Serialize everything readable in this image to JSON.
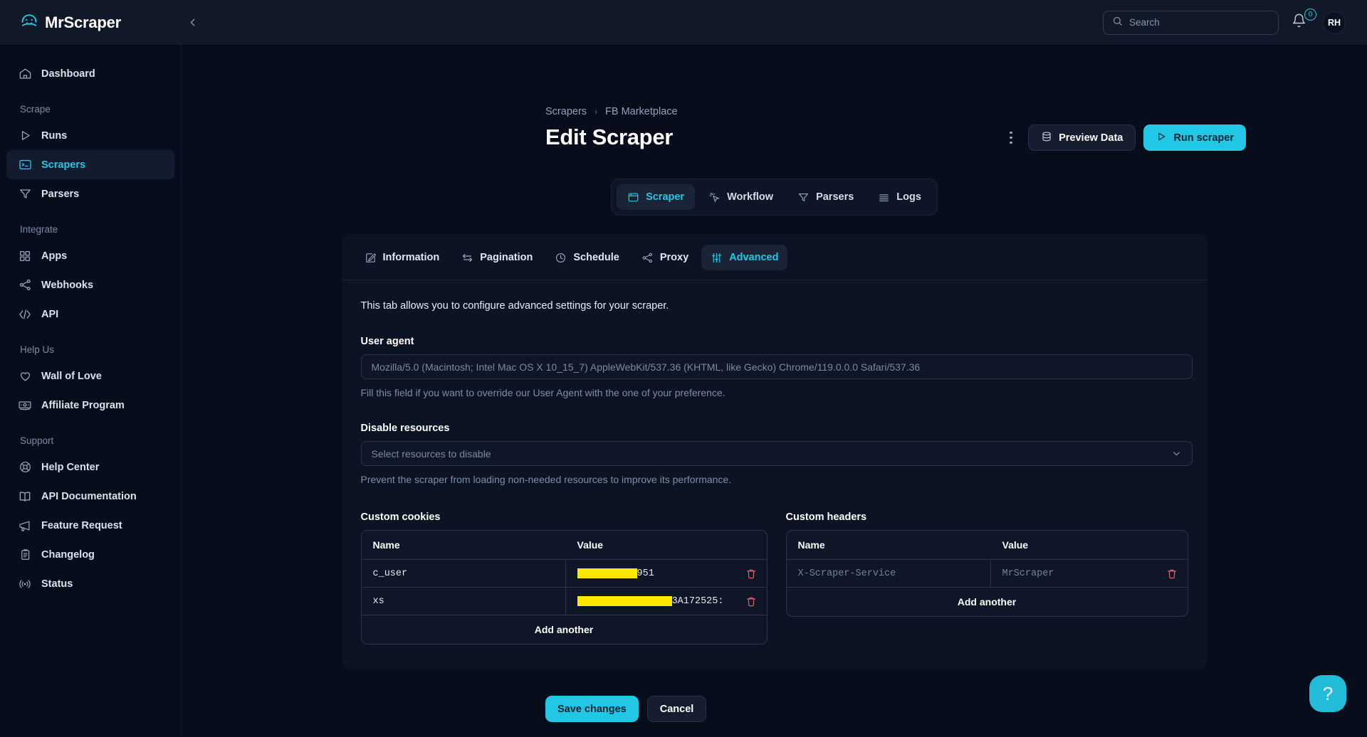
{
  "brand": {
    "name": "MrScraper",
    "logo_icon": "scraper-face-logo-icon"
  },
  "topbar": {
    "collapse_icon": "chevron-left-icon",
    "search": {
      "placeholder": "Search",
      "value": "",
      "icon": "search-icon"
    },
    "notifications": {
      "icon": "bell-icon",
      "count": "0",
      "accent": "#2ec5dd"
    },
    "avatar": {
      "initials": "RH"
    }
  },
  "sidebar": {
    "primary": [
      {
        "label": "Dashboard",
        "icon": "home-icon",
        "active": false
      }
    ],
    "groups": [
      {
        "label": "Scrape",
        "items": [
          {
            "label": "Runs",
            "icon": "play-icon",
            "active": false
          },
          {
            "label": "Scrapers",
            "icon": "terminal-icon",
            "active": true
          },
          {
            "label": "Parsers",
            "icon": "funnel-icon",
            "active": false
          }
        ]
      },
      {
        "label": "Integrate",
        "items": [
          {
            "label": "Apps",
            "icon": "grid-icon",
            "active": false
          },
          {
            "label": "Webhooks",
            "icon": "share-nodes-icon",
            "active": false
          },
          {
            "label": "API",
            "icon": "code-brackets-icon",
            "active": false
          }
        ]
      },
      {
        "label": "Help Us",
        "items": [
          {
            "label": "Wall of Love",
            "icon": "heart-icon",
            "active": false
          },
          {
            "label": "Affiliate Program",
            "icon": "banknote-icon",
            "active": false
          }
        ]
      },
      {
        "label": "Support",
        "items": [
          {
            "label": "Help Center",
            "icon": "lifebuoy-icon",
            "active": false
          },
          {
            "label": "API Documentation",
            "icon": "book-open-icon",
            "active": false
          },
          {
            "label": "Feature Request",
            "icon": "megaphone-icon",
            "active": false
          },
          {
            "label": "Changelog",
            "icon": "clipboard-list-icon",
            "active": false
          },
          {
            "label": "Status",
            "icon": "broadcast-icon",
            "active": false
          }
        ]
      }
    ]
  },
  "page": {
    "breadcrumb": [
      "Scrapers",
      "FB Marketplace"
    ],
    "breadcrumb_separator": "›",
    "title": "Edit Scraper",
    "actions": {
      "kebab_icon": "more-vertical-icon",
      "preview": {
        "label": "Preview Data",
        "icon": "database-icon"
      },
      "run": {
        "label": "Run scraper",
        "icon": "play-icon",
        "color": "#22c7e6"
      }
    }
  },
  "main_tabs": [
    {
      "label": "Scraper",
      "icon": "browser-window-icon",
      "active": true
    },
    {
      "label": "Workflow",
      "icon": "cursor-click-icon",
      "active": false
    },
    {
      "label": "Parsers",
      "icon": "funnel-icon",
      "active": false
    },
    {
      "label": "Logs",
      "icon": "list-lines-icon",
      "active": false
    }
  ],
  "panel_tabs": [
    {
      "label": "Information",
      "icon": "pencil-square-icon",
      "active": false
    },
    {
      "label": "Pagination",
      "icon": "arrows-swap-icon",
      "active": false
    },
    {
      "label": "Schedule",
      "icon": "clock-icon",
      "active": false
    },
    {
      "label": "Proxy",
      "icon": "share-nodes-icon",
      "active": false
    },
    {
      "label": "Advanced",
      "icon": "sliders-icon",
      "active": true
    }
  ],
  "advanced": {
    "intro": "This tab allows you to configure advanced settings for your scraper.",
    "user_agent": {
      "label": "User agent",
      "value": "",
      "placeholder": "Mozilla/5.0 (Macintosh; Intel Mac OS X 10_15_7) AppleWebKit/537.36 (KHTML, like Gecko) Chrome/119.0.0.0 Safari/537.36",
      "hint": "Fill this field if you want to override our User Agent with the one of your preference."
    },
    "disable_resources": {
      "label": "Disable resources",
      "selected_text": "Select resources to disable",
      "chevron_icon": "chevron-down-icon",
      "hint": "Prevent the scraper from loading non-needed resources to improve its performance."
    },
    "cookies": {
      "title": "Custom cookies",
      "columns": [
        "Name",
        "Value"
      ],
      "rows": [
        {
          "name": "c_user",
          "redacted_width": 84,
          "value_suffix": "951",
          "delete_icon": "trash-icon"
        },
        {
          "name": "xs",
          "redacted_width": 158,
          "value_suffix": "3A172525:",
          "delete_icon": "trash-icon"
        }
      ],
      "add_label": "Add another",
      "redaction_color": "#ffe800"
    },
    "headers": {
      "title": "Custom headers",
      "columns": [
        "Name",
        "Value"
      ],
      "rows": [
        {
          "name": "X-Scraper-Service",
          "value": "MrScraper",
          "placeholder": true,
          "delete_icon": "trash-icon"
        }
      ],
      "add_label": "Add another"
    },
    "save_label": "Save changes",
    "cancel_label": "Cancel"
  },
  "help_fab": {
    "glyph": "?",
    "icon": "question-mark-icon",
    "color": "#22bcd8"
  }
}
